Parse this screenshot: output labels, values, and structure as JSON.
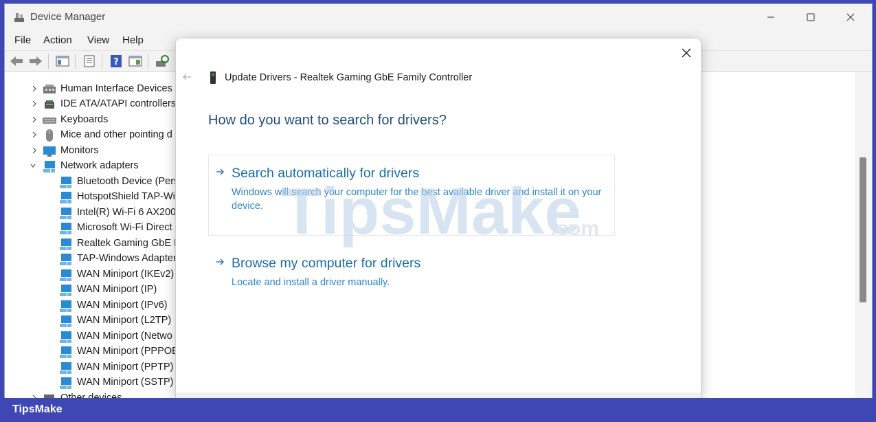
{
  "window": {
    "title": "Device Manager"
  },
  "menu": [
    "File",
    "Action",
    "View",
    "Help"
  ],
  "tree": [
    {
      "label": "Human Interface Devices",
      "icon": "hid-icon",
      "level": 0,
      "state": "collapsed"
    },
    {
      "label": "IDE ATA/ATAPI controllers",
      "icon": "ide-icon",
      "level": 0,
      "state": "collapsed"
    },
    {
      "label": "Keyboards",
      "icon": "keyboard-icon",
      "level": 0,
      "state": "collapsed"
    },
    {
      "label": "Mice and other pointing d",
      "icon": "mouse-icon",
      "level": 0,
      "state": "collapsed"
    },
    {
      "label": "Monitors",
      "icon": "monitor-icon",
      "level": 0,
      "state": "collapsed"
    },
    {
      "label": "Network adapters",
      "icon": "network-icon",
      "level": 0,
      "state": "expanded"
    },
    {
      "label": "Bluetooth Device (Pers",
      "icon": "network-icon",
      "level": 1
    },
    {
      "label": "HotspotShield TAP-Wi",
      "icon": "network-icon",
      "level": 1
    },
    {
      "label": "Intel(R) Wi-Fi 6 AX200",
      "icon": "network-icon",
      "level": 1
    },
    {
      "label": "Microsoft Wi-Fi Direct",
      "icon": "network-icon",
      "level": 1
    },
    {
      "label": "Realtek Gaming GbE F",
      "icon": "network-icon",
      "level": 1
    },
    {
      "label": "TAP-Windows Adapter",
      "icon": "network-icon",
      "level": 1
    },
    {
      "label": "WAN Miniport (IKEv2)",
      "icon": "network-icon",
      "level": 1
    },
    {
      "label": "WAN Miniport (IP)",
      "icon": "network-icon",
      "level": 1
    },
    {
      "label": "WAN Miniport (IPv6)",
      "icon": "network-icon",
      "level": 1
    },
    {
      "label": "WAN Miniport (L2TP)",
      "icon": "network-icon",
      "level": 1
    },
    {
      "label": "WAN Miniport (Netwo",
      "icon": "network-icon",
      "level": 1
    },
    {
      "label": "WAN Miniport (PPPOE",
      "icon": "network-icon",
      "level": 1
    },
    {
      "label": "WAN Miniport (PPTP)",
      "icon": "network-icon",
      "level": 1
    },
    {
      "label": "WAN Miniport (SSTP)",
      "icon": "network-icon",
      "level": 1
    },
    {
      "label": "Other devices",
      "icon": "other-devices-icon",
      "level": 0,
      "state": "collapsed"
    }
  ],
  "dialog": {
    "title": "Update Drivers - Realtek Gaming GbE Family Controller",
    "heading": "How do you want to search for drivers?",
    "options": [
      {
        "title": "Search automatically for drivers",
        "description": "Windows will search your computer for the best available driver and install it on your device."
      },
      {
        "title": "Browse my computer for drivers",
        "description": "Locate and install a driver manually."
      }
    ]
  },
  "watermark": {
    "text": "TipsMake",
    "suffix": ".com"
  },
  "brand": {
    "text": "TipsMake"
  },
  "colors": {
    "accent": "#1a6ea8",
    "link": "#2b86c9",
    "heading": "#1f4e79",
    "frame": "#3f47b5"
  }
}
